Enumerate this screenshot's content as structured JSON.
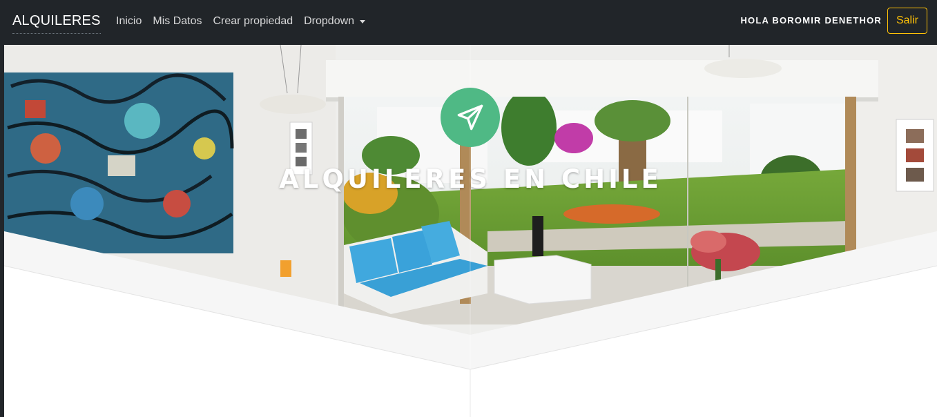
{
  "navbar": {
    "brand": "ALQUILERES",
    "links": [
      "Inicio",
      "Mis Datos",
      "Crear propiedad"
    ],
    "dropdown_label": "Dropdown",
    "greeting": "HOLA BOROMIR DENETHOR",
    "logout_label": "Salir"
  },
  "hero": {
    "title": "ALQUILERES EN CHILE",
    "icon": "paper-plane-icon"
  },
  "colors": {
    "navbar_bg": "#212529",
    "accent_yellow": "#ffc107",
    "icon_green": "#4fb985"
  }
}
